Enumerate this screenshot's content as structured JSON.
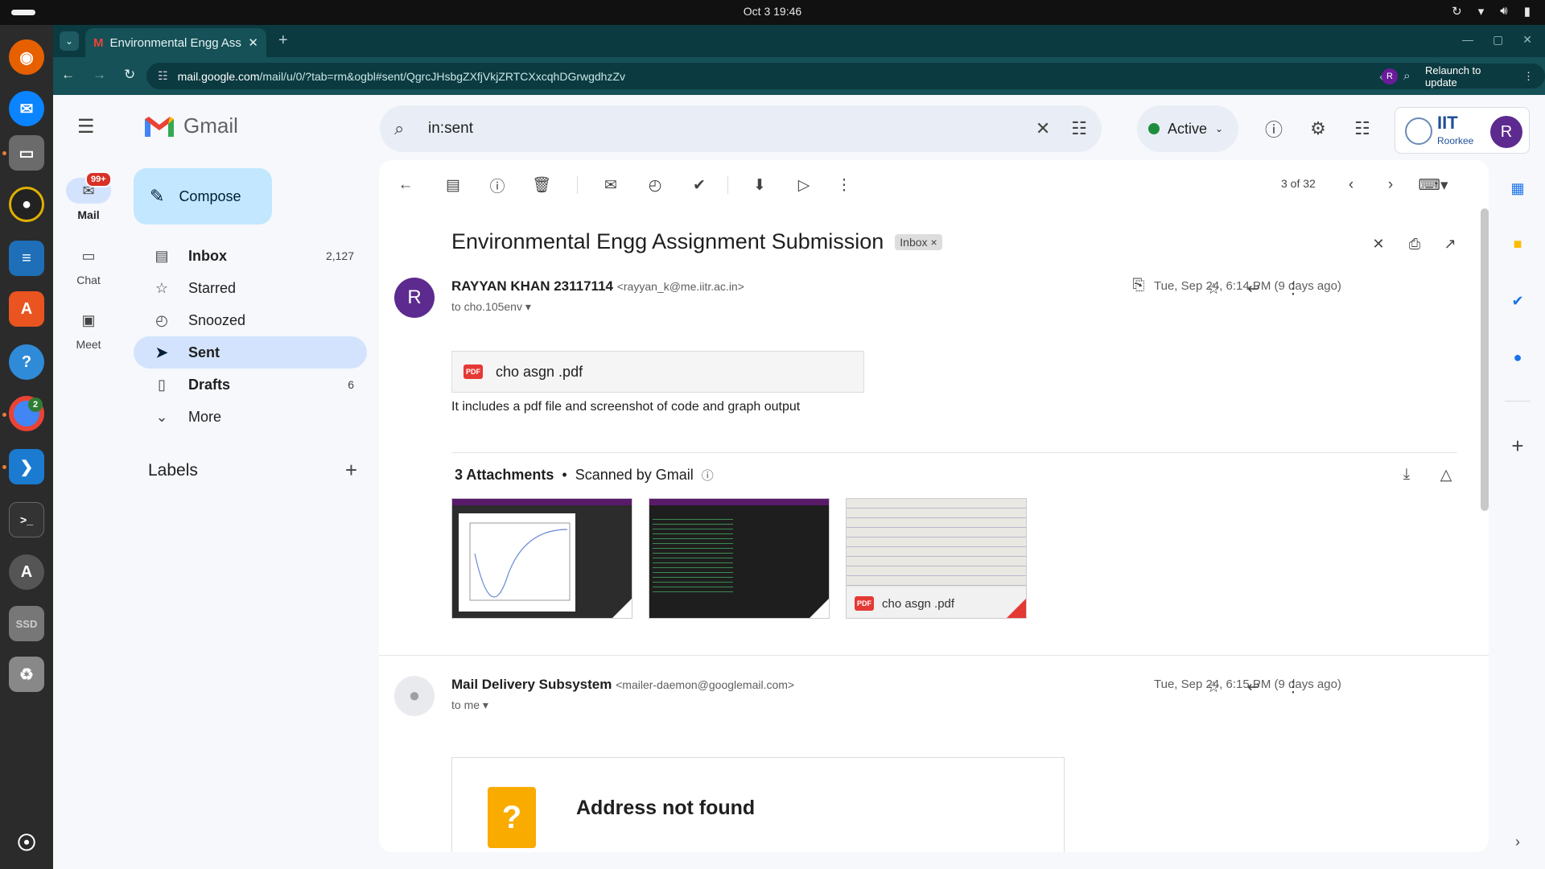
{
  "os": {
    "clock": "Oct 3  19:46",
    "tray_icons": [
      "update-icon",
      "wifi-icon",
      "volume-icon",
      "battery-icon"
    ]
  },
  "dock": {
    "items": [
      {
        "name": "firefox",
        "color": "#e66000"
      },
      {
        "name": "thunderbird",
        "color": "#0a84ff"
      },
      {
        "name": "files",
        "color": "#6b6b6b"
      },
      {
        "name": "rhythmbox",
        "color": "#e0b000"
      },
      {
        "name": "writer",
        "color": "#1e6fb8"
      },
      {
        "name": "app-center",
        "color": "#e95420"
      },
      {
        "name": "help",
        "color": "#2f8bd8"
      },
      {
        "name": "chrome",
        "color": "#4285f4",
        "badge": "2"
      },
      {
        "name": "vscode",
        "color": "#1a7bd0"
      },
      {
        "name": "terminal",
        "color": "#333333"
      },
      {
        "name": "software-updater",
        "color": "#555555"
      },
      {
        "name": "ssd-drive",
        "color": "#777777",
        "label": "SSD"
      },
      {
        "name": "trash",
        "color": "#888888"
      }
    ]
  },
  "browser": {
    "tab_title": "Environmental Engg Assi",
    "url_host": "mail.google.com",
    "url_path": "/mail/u/0/?tab=rm&ogbl#sent/QgrcJHsbgZXfjVkjZRTCXxcqhDGrwgdhzZv",
    "profile_initial": "R",
    "relaunch_label": "Relaunch to update"
  },
  "gmail": {
    "logo_text": "Gmail",
    "search_query": "in:sent",
    "status_label": "Active",
    "org_name_top": "IIT",
    "org_name_bottom": "Roorkee",
    "account_initial": "R"
  },
  "rail": [
    {
      "label": "Mail",
      "badge": "99+",
      "active": true
    },
    {
      "label": "Chat",
      "active": false
    },
    {
      "label": "Meet",
      "active": false
    }
  ],
  "nav": {
    "compose_label": "Compose",
    "items": [
      {
        "label": "Inbox",
        "count": "2,127",
        "bold": true
      },
      {
        "label": "Starred",
        "count": ""
      },
      {
        "label": "Snoozed",
        "count": ""
      },
      {
        "label": "Sent",
        "count": "",
        "active": true
      },
      {
        "label": "Drafts",
        "count": "6",
        "bold": true
      },
      {
        "label": "More",
        "count": ""
      }
    ],
    "labels_heading": "Labels"
  },
  "toolbar": {
    "pager": "3 of 32"
  },
  "thread": {
    "subject": "Environmental Engg Assignment Submission",
    "label_chip": "Inbox",
    "messages": [
      {
        "avatar_initial": "R",
        "sender_name": "RAYYAN KHAN 23117114",
        "sender_email": "<rayyan_k@me.iitr.ac.in>",
        "recipient": "to cho.105env",
        "date": "Tue, Sep 24, 6:14 PM (9 days ago)",
        "inline_attachment": "cho asgn .pdf",
        "body": "It includes a pdf file and screenshot of code and graph output",
        "attachments_heading": "3 Attachments",
        "scanned_label": "Scanned by Gmail",
        "attachments": [
          {
            "kind": "image",
            "caption": ""
          },
          {
            "kind": "image",
            "caption": ""
          },
          {
            "kind": "pdf",
            "caption": "cho asgn .pdf"
          }
        ]
      },
      {
        "sender_name": "Mail Delivery Subsystem",
        "sender_email": "<mailer-daemon@googlemail.com>",
        "recipient": "to me",
        "date": "Tue, Sep 24, 6:15 PM (9 days ago)",
        "bounce_title": "Address not found"
      }
    ]
  },
  "colors": {
    "accent_blue": "#0b57d0",
    "nav_active": "#d3e3fd",
    "compose_bg": "#c2e7ff",
    "avatar_purple": "#5d2a8f",
    "chrome_teal": "#155157"
  }
}
